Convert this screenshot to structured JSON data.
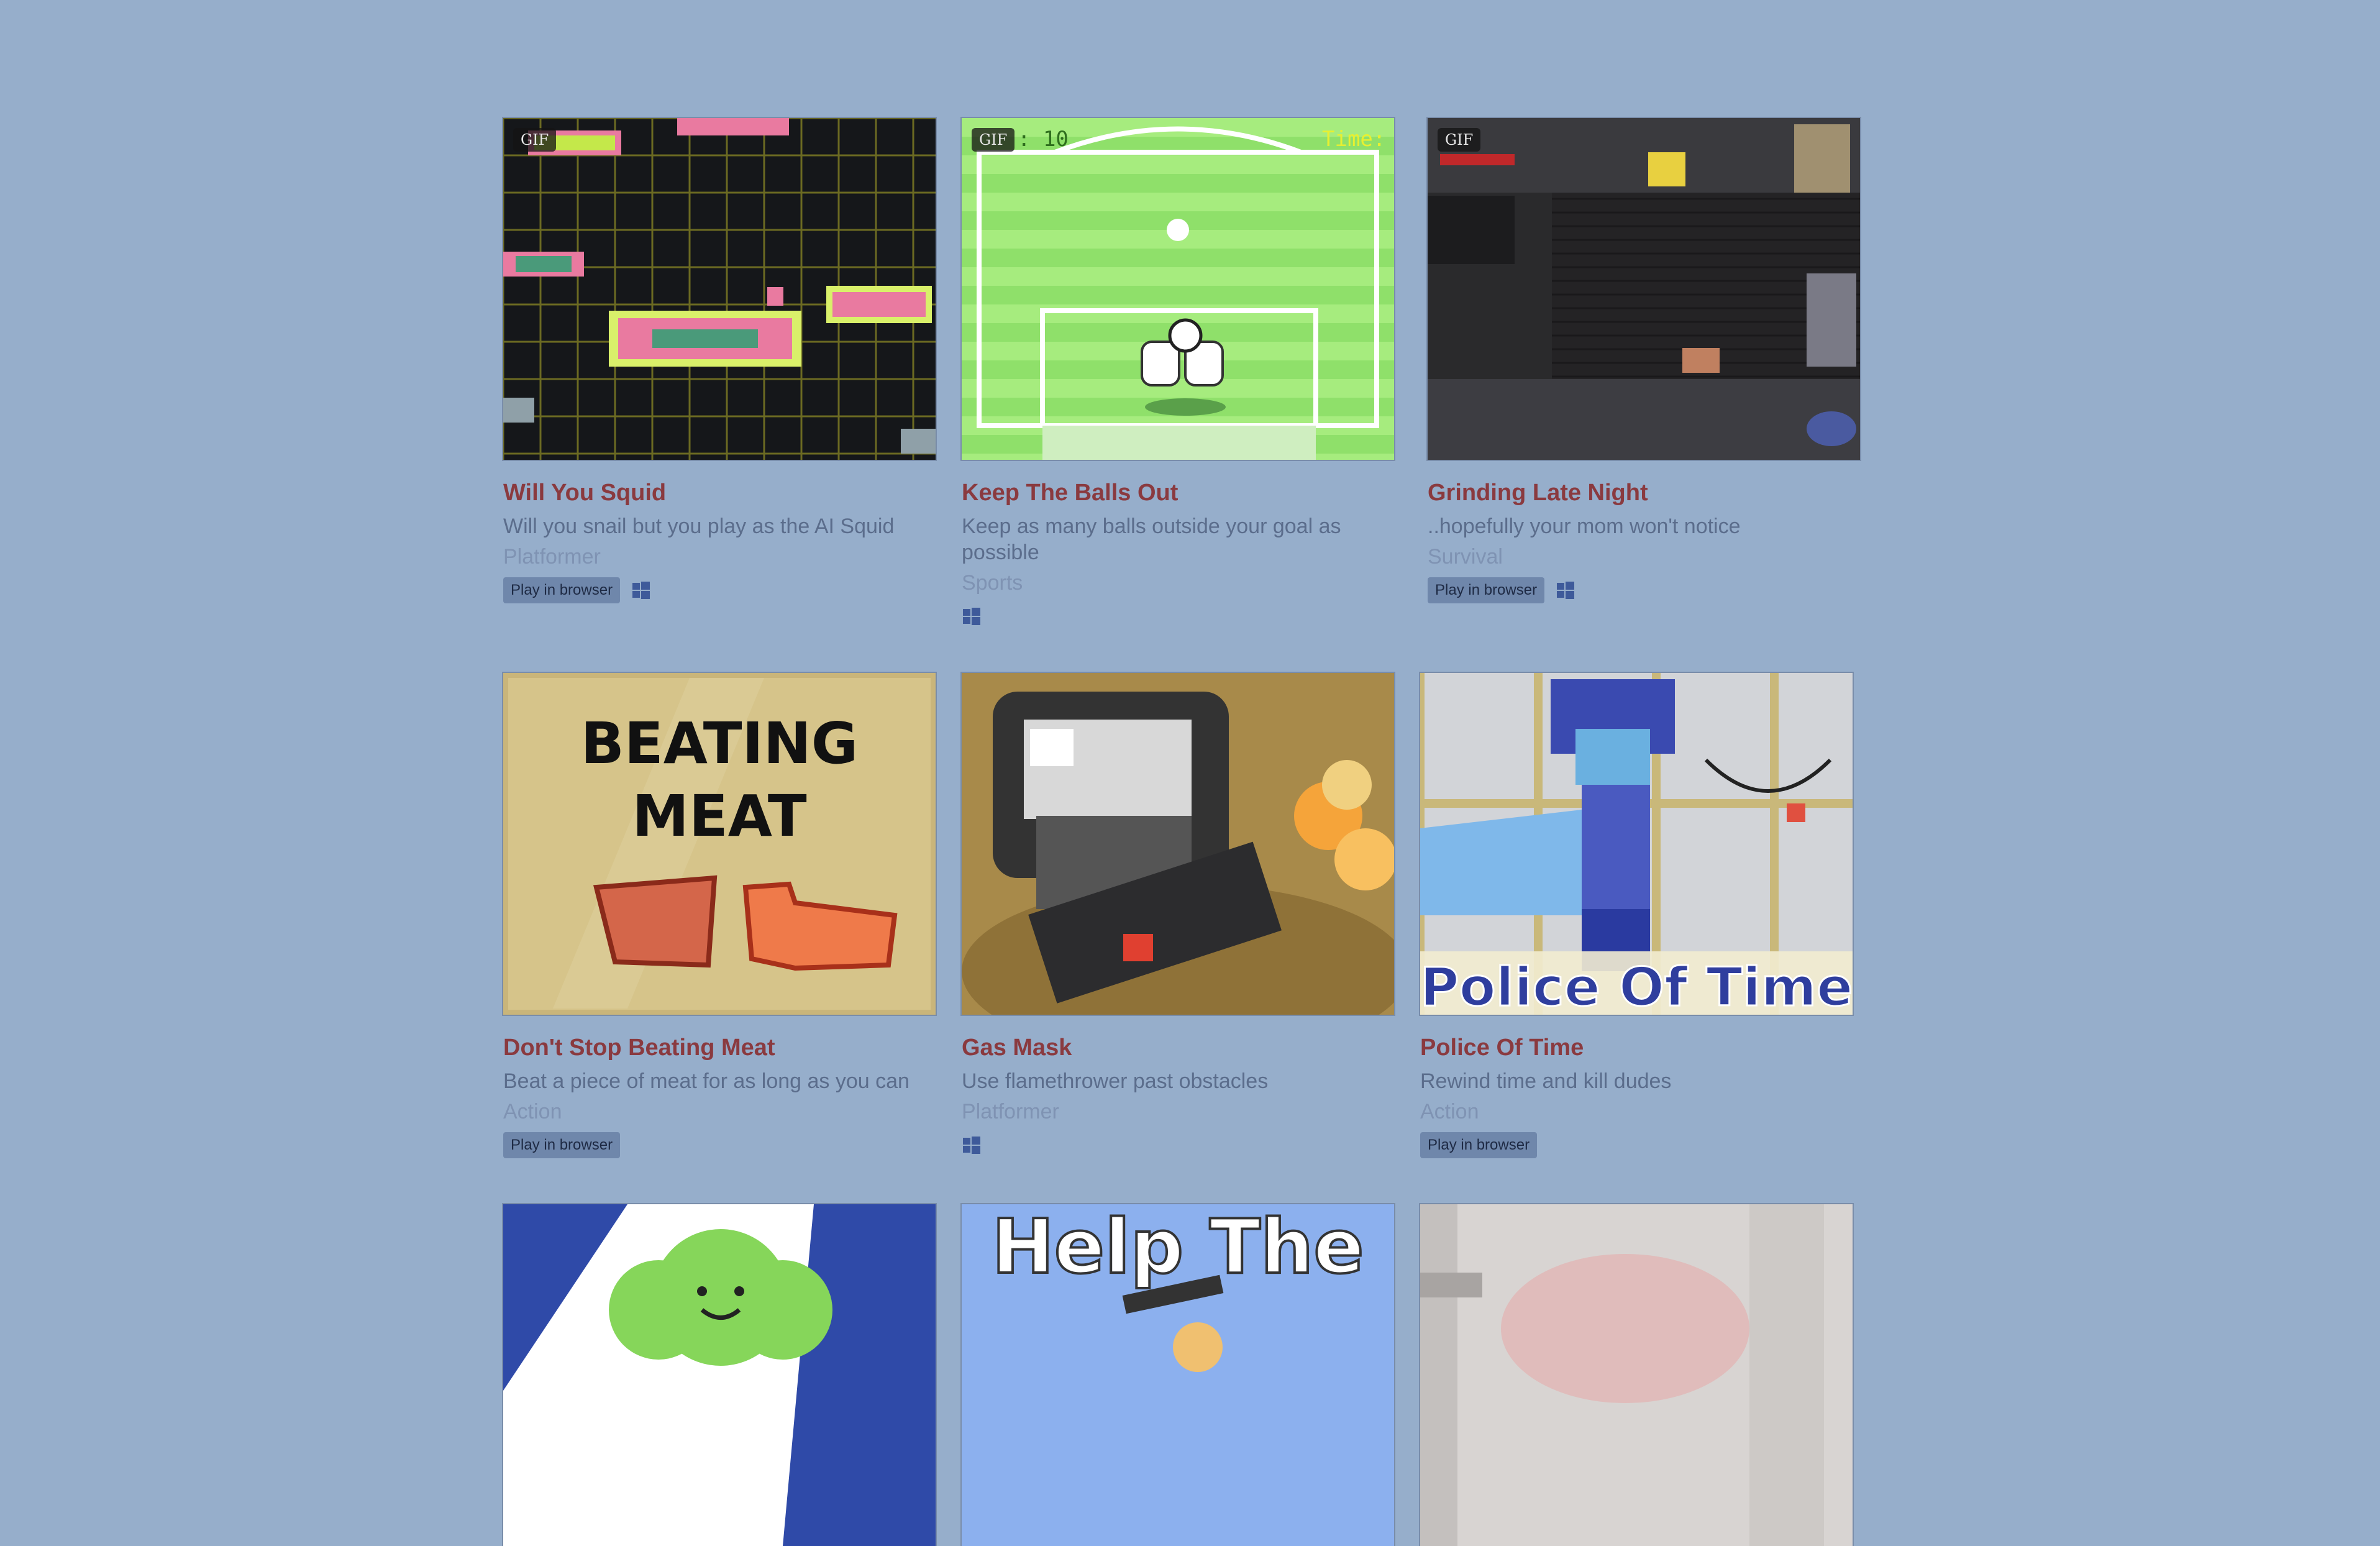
{
  "games": [
    {
      "title": "Will You Squid",
      "description": "Will you snail but you play as the AI Squid",
      "genre": "Platformer",
      "gif": "GIF",
      "play_label": "Play in browser",
      "platform_icon": "windows-icon",
      "art": "squid"
    },
    {
      "title": "Keep The Balls Out",
      "description": "Keep as many balls outside your goal as possible",
      "genre": "Sports",
      "gif": "GIF",
      "play_label": "",
      "platform_icon": "windows-icon",
      "art": "goal",
      "hud_left": ": 10",
      "hud_right": "Time:"
    },
    {
      "title": "Grinding Late Night",
      "description": "..hopefully your mom won't notice",
      "genre": "Survival",
      "gif": "GIF",
      "play_label": "Play in browser",
      "platform_icon": "windows-icon",
      "art": "night"
    },
    {
      "title": "Don't Stop Beating Meat",
      "description": "Beat a piece of meat for as long as you can",
      "genre": "Action",
      "gif": "",
      "play_label": "Play in browser",
      "platform_icon": "",
      "art": "meat",
      "art_line1": "BEATING",
      "art_line2": "MEAT"
    },
    {
      "title": "Gas Mask",
      "description": "Use flamethrower past obstacles",
      "genre": "Platformer",
      "gif": "",
      "play_label": "",
      "platform_icon": "windows-icon",
      "art": "gasmask"
    },
    {
      "title": "Police Of Time",
      "description": "Rewind time and kill dudes",
      "genre": "Action",
      "gif": "",
      "play_label": "Play in browser",
      "platform_icon": "",
      "art": "police",
      "art_line1": "Police Of Time"
    },
    {
      "title": "",
      "description": "",
      "genre": "",
      "gif": "",
      "play_label": "",
      "platform_icon": "",
      "art": "cloud"
    },
    {
      "title": "",
      "description": "",
      "genre": "",
      "gif": "",
      "play_label": "",
      "platform_icon": "",
      "art": "help",
      "art_line1": "Help The"
    },
    {
      "title": "",
      "description": "",
      "genre": "",
      "gif": "",
      "play_label": "",
      "platform_icon": "",
      "art": "blur"
    }
  ],
  "colors": {
    "background": "#96aecb",
    "title": "#8a3a3f",
    "description": "#5b6d8c",
    "genre": "#7f93b3",
    "button": "#6f87ab"
  }
}
